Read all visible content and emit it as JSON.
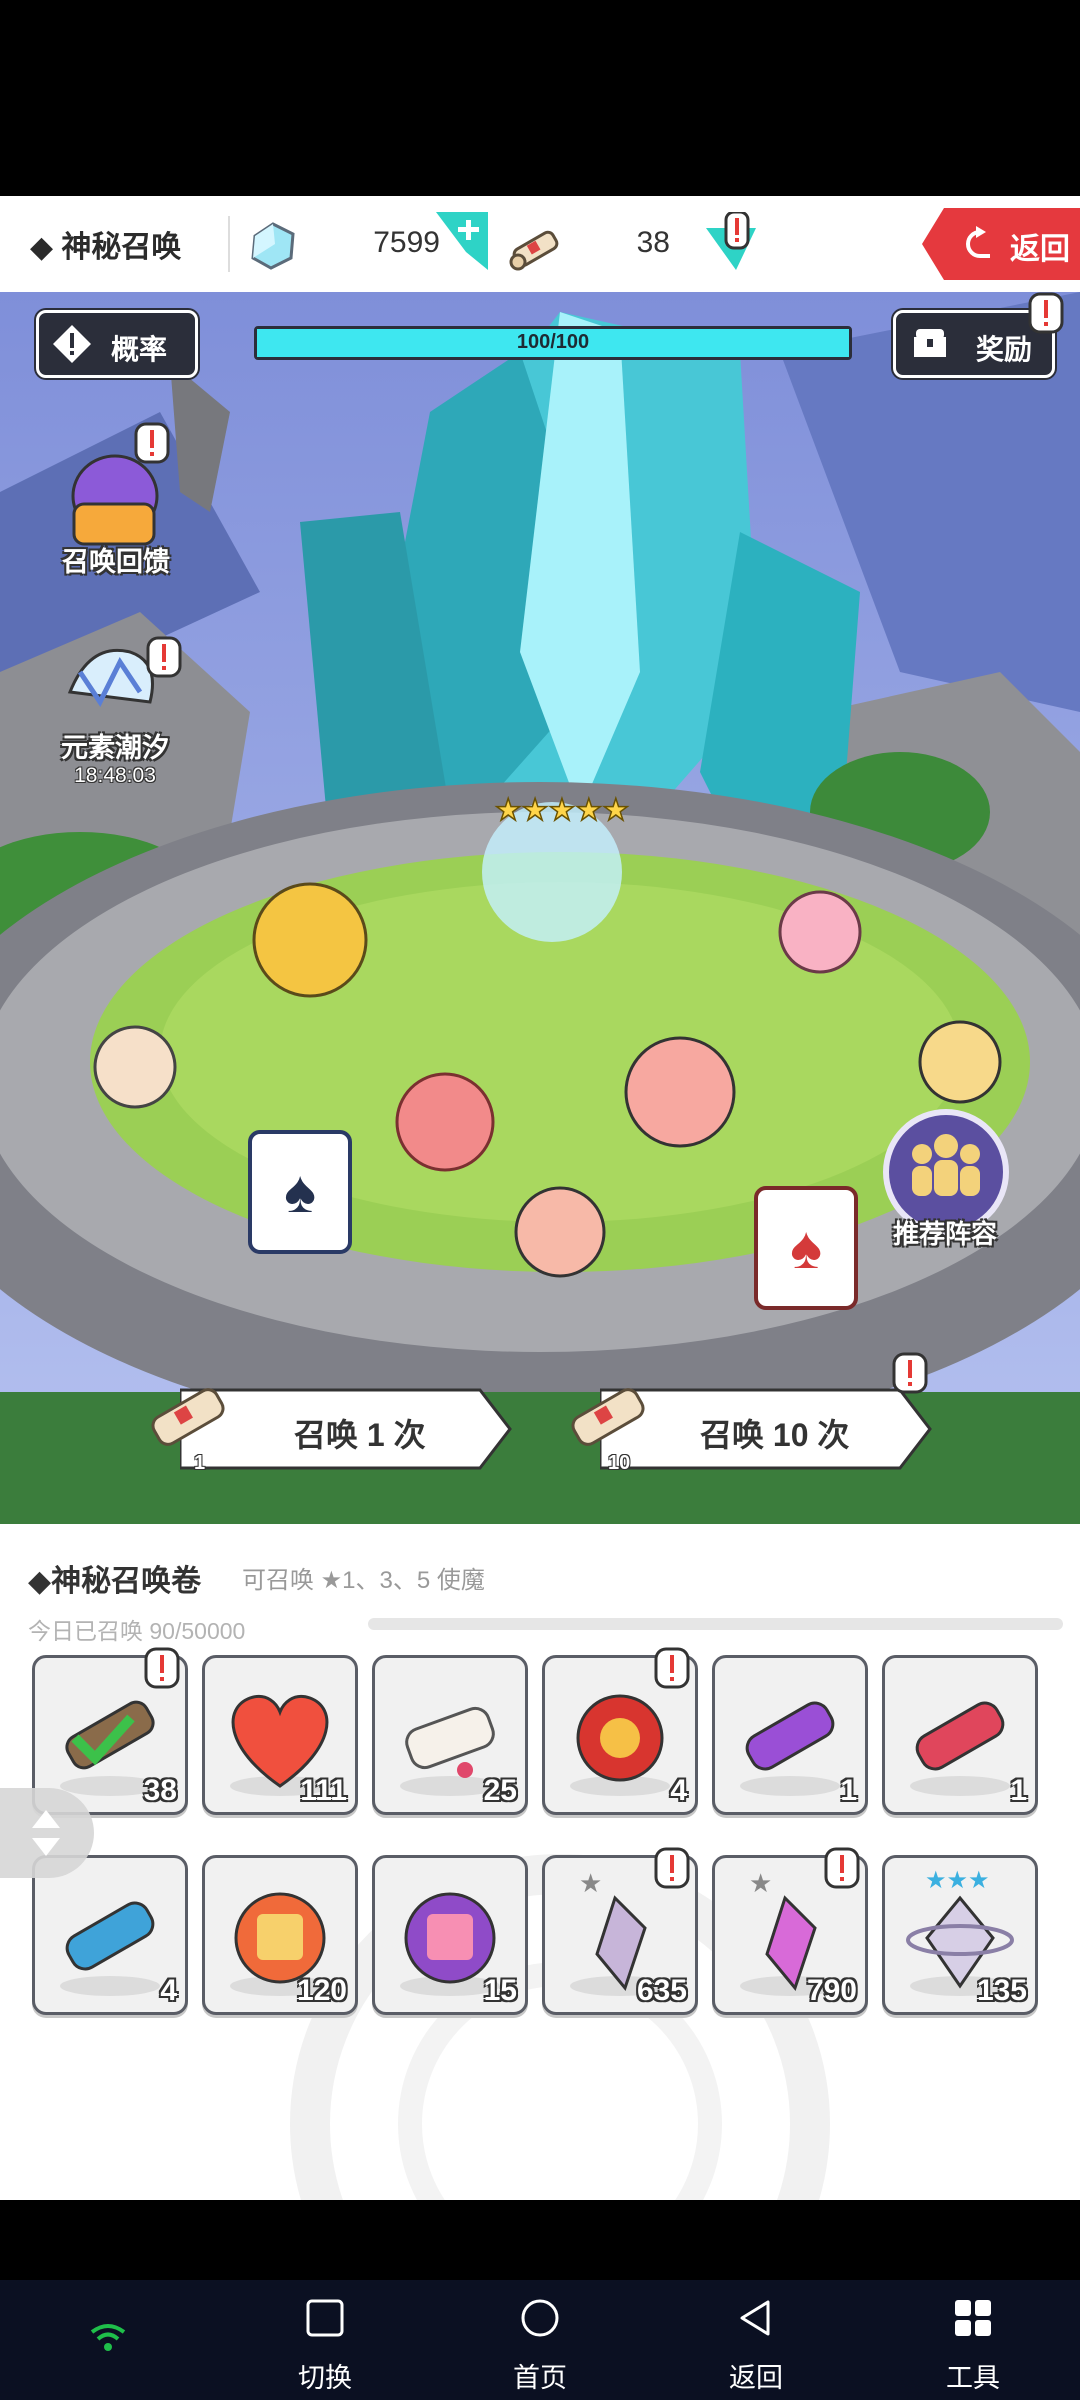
{
  "header": {
    "title": "◆ 神秘召唤",
    "gem_count": "7599",
    "scroll_count": "38",
    "return_label": "返回"
  },
  "scene": {
    "probability_label": "概率",
    "reward_label": "奖励",
    "progress_text": "100/100",
    "progress_fraction": 1.0,
    "summon_feedback_label": "召唤回馈",
    "element_tide_label": "元素潮汐",
    "element_tide_timer": "18:48:03",
    "recommend_label": "推荐阵容",
    "summon_once_label": "召唤 1 次",
    "summon_once_cost": "1",
    "summon_ten_label": "召唤 10 次",
    "summon_ten_cost": "10"
  },
  "panel": {
    "title": "◆神秘召唤卷",
    "subtitle": "可召唤 ★1、3、5 使魔",
    "today_label": "今日已召唤 90/50000",
    "items": [
      {
        "name": "summon-scroll-icon",
        "count": "38"
      },
      {
        "name": "heart-icon",
        "count": "111"
      },
      {
        "name": "white-scroll-icon",
        "count": "25"
      },
      {
        "name": "red-bundle-icon",
        "count": "4"
      },
      {
        "name": "purple-scroll-icon",
        "count": "1"
      },
      {
        "name": "red-scroll-icon",
        "count": "1"
      },
      {
        "name": "blue-scroll-icon",
        "count": "4"
      },
      {
        "name": "orange-ticket-icon",
        "count": "120"
      },
      {
        "name": "purple-ticket-icon",
        "count": "15"
      },
      {
        "name": "shard-1star-icon",
        "count": "635"
      },
      {
        "name": "shard-1star-pink-icon",
        "count": "790"
      },
      {
        "name": "shard-3star-icon",
        "count": "135"
      }
    ]
  },
  "navbar": {
    "switch_label": "切换",
    "home_label": "首页",
    "back_label": "返回",
    "tools_label": "工具"
  },
  "colors": {
    "accent_red": "#e5393e",
    "gem_teal": "#2ed3c6",
    "progress_cyan": "#3ee7f0",
    "navbar_bg": "#0b1022"
  }
}
